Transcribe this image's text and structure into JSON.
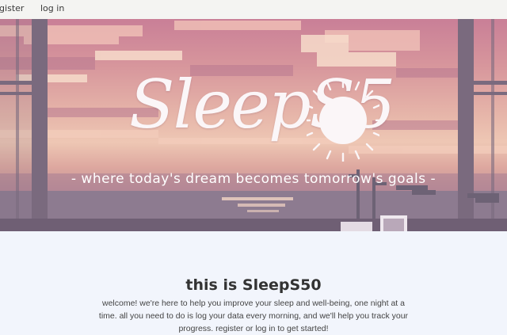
{
  "nav": {
    "register_label": "register",
    "login_label": "log in"
  },
  "hero": {
    "logo_text": "SleepS5",
    "tagline": "- where today's dream becomes tomorrow's goals -"
  },
  "main": {
    "heading": "this is SleepS50",
    "intro": "welcome! we're here to help you improve your sleep and well-being, one night at a time. all you need to do is log your data every morning, and we'll help you track your progress. register or log in to get started!"
  },
  "colors": {
    "nav_bg": "#f4f4f2",
    "page_bg": "#f2f5fc",
    "text": "#333333"
  }
}
